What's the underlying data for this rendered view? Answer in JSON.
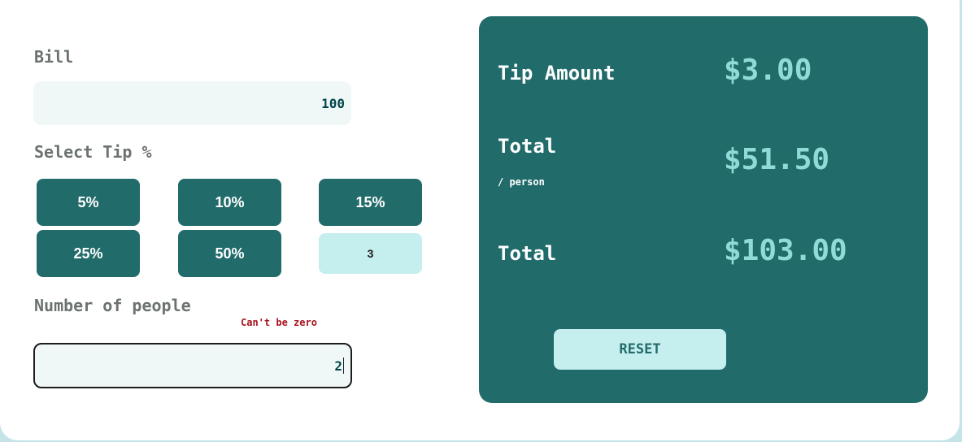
{
  "bill": {
    "label": "Bill",
    "value": "100"
  },
  "tip": {
    "label": "Select Tip %",
    "options": [
      "5%",
      "10%",
      "15%",
      "25%",
      "50%"
    ],
    "custom_value": "3"
  },
  "people": {
    "label": "Number of people",
    "error": "Can't be zero",
    "value": "2"
  },
  "results": {
    "tip_amount_label": "Tip Amount",
    "tip_amount_value": "$3.00",
    "total_per_person_label": "Total",
    "total_per_person_sub": "/ person",
    "total_per_person_value": "$51.50",
    "total_label": "Total",
    "total_value": "$103.00",
    "reset_label": "RESET"
  },
  "colors": {
    "panel": "#226b6b",
    "accent": "#8fdcd7",
    "input_bg": "#f0f8f7",
    "error": "#a8121d"
  }
}
